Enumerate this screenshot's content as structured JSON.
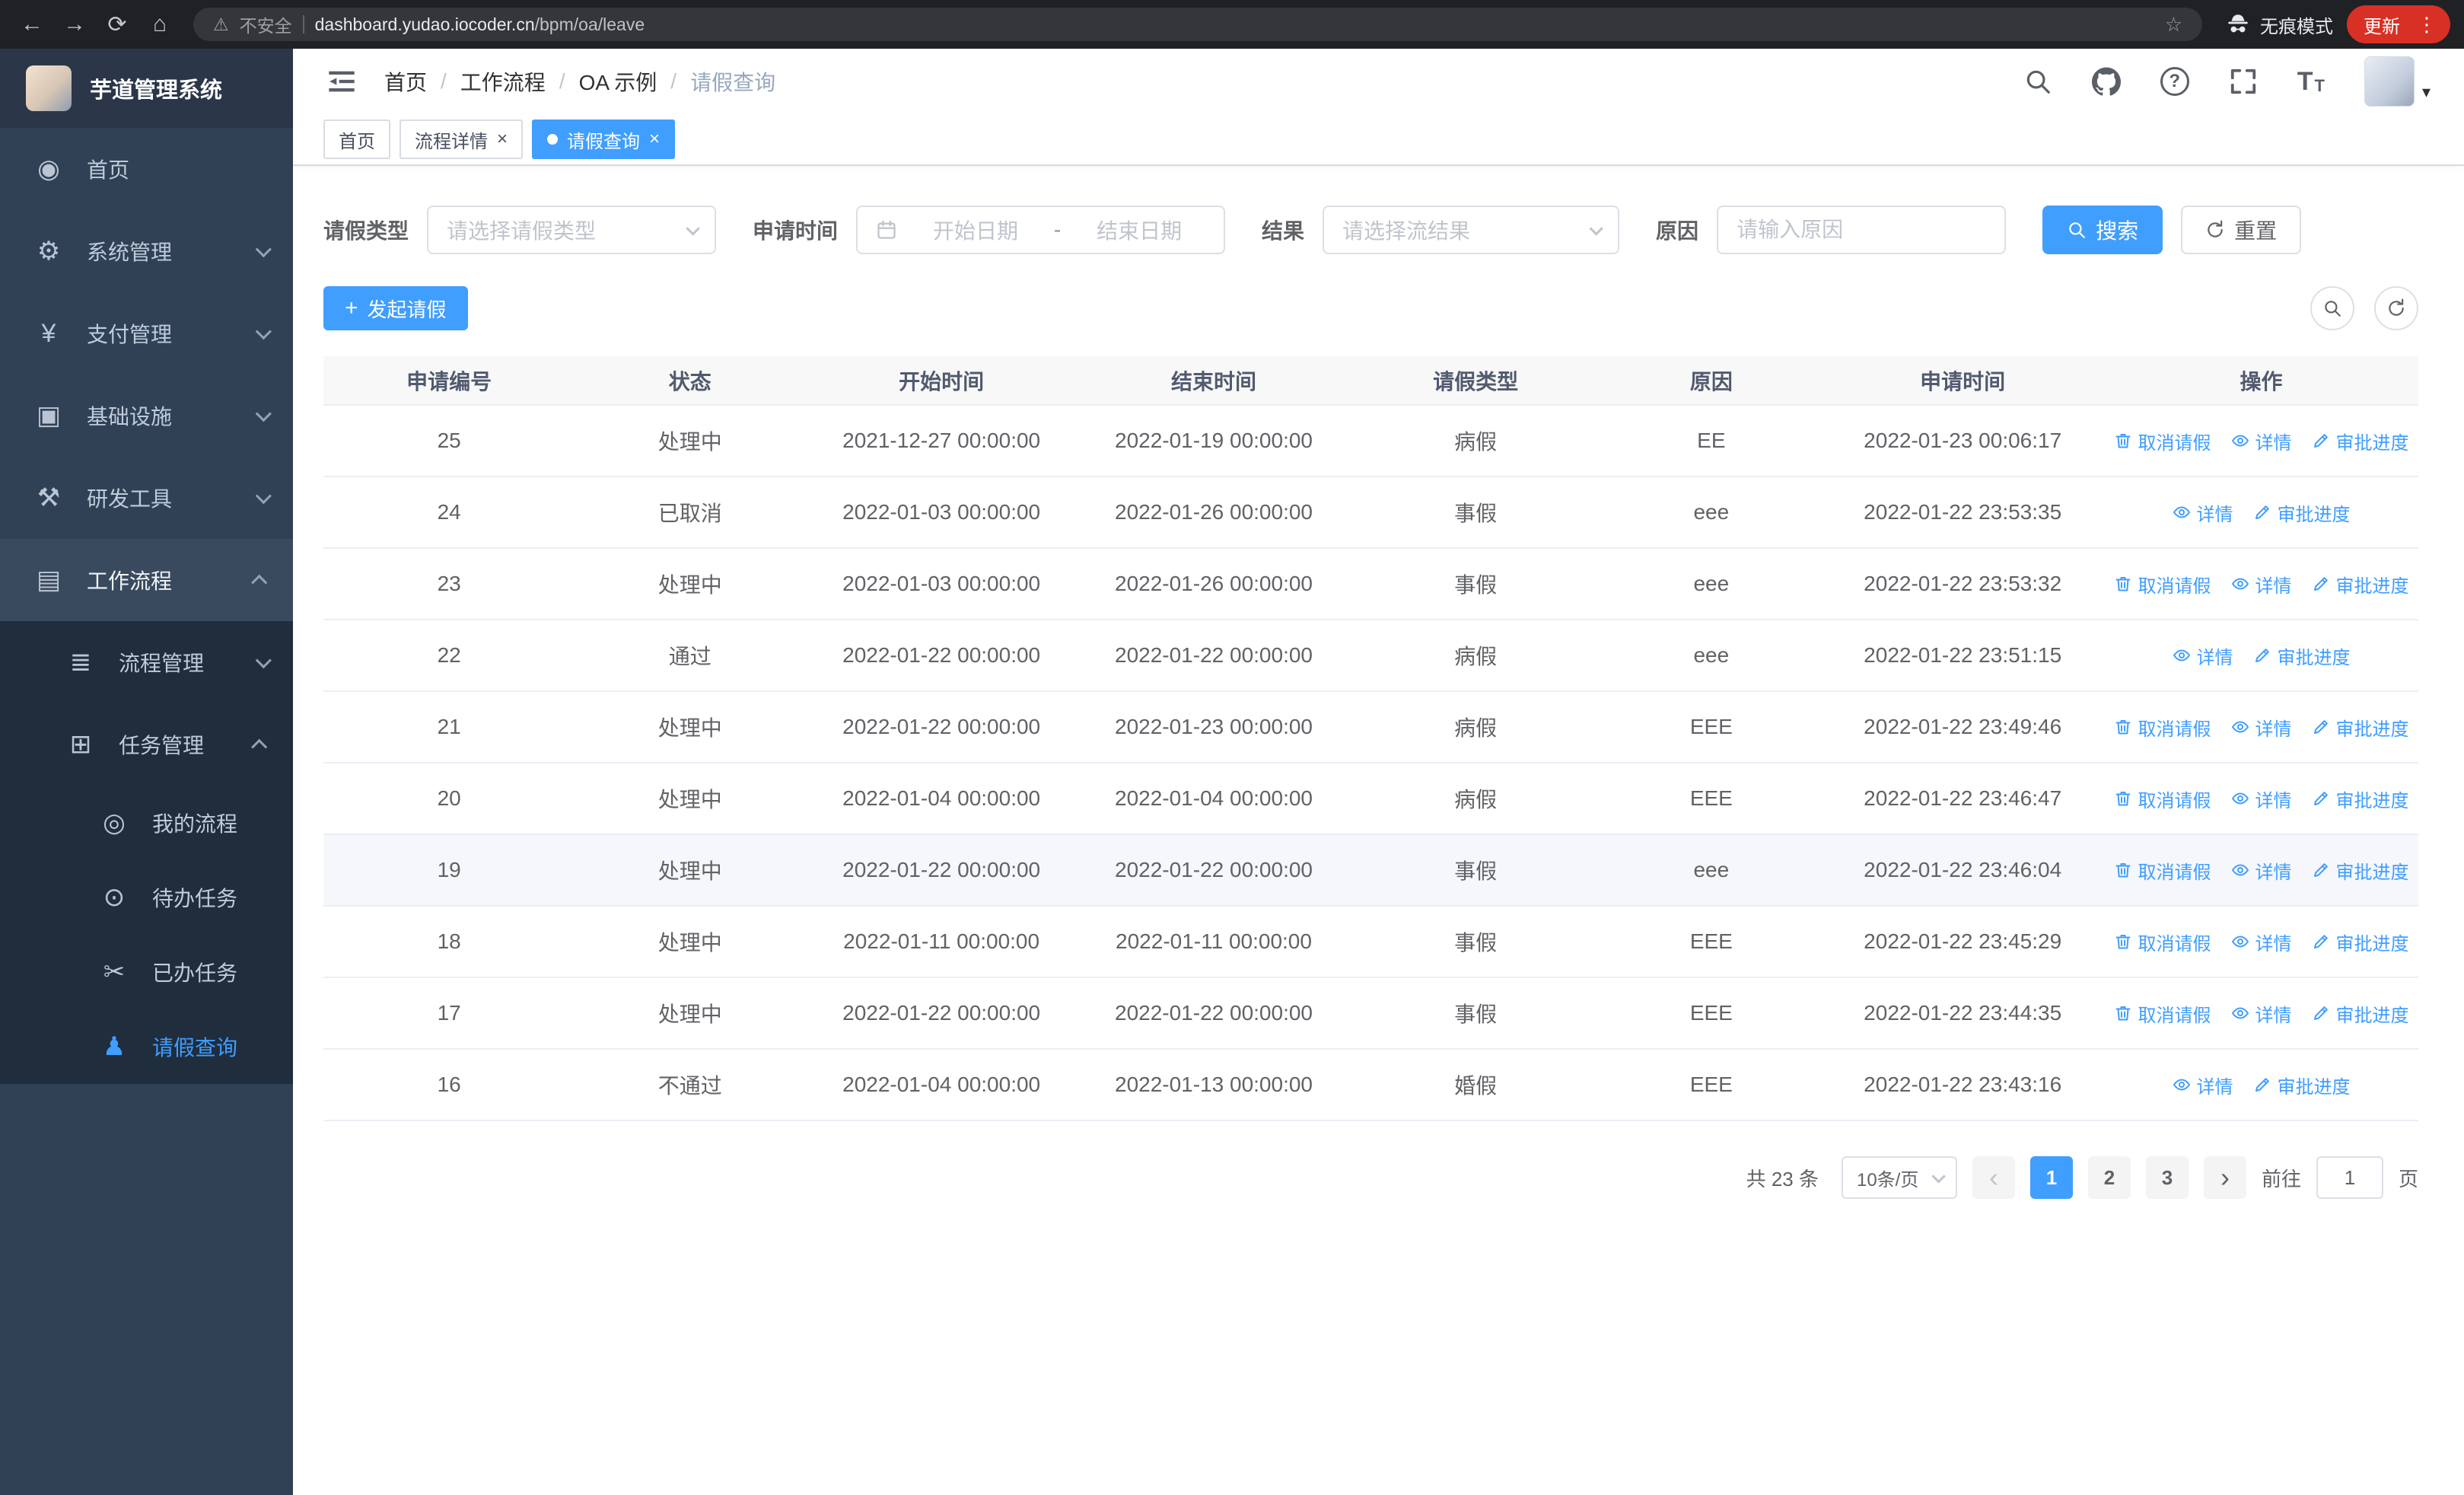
{
  "browser": {
    "security_label": "不安全",
    "url_domain": "dashboard.yudao.iocoder.cn",
    "url_path": "/bpm/oa/leave",
    "incognito_label": "无痕模式",
    "update_label": "更新"
  },
  "icons": {
    "back": "←",
    "forward": "→",
    "reload": "⟳",
    "home": "⌂",
    "warning": "⚠",
    "star": "☆",
    "dots": "⋮",
    "caret": "▾",
    "question": "?",
    "font_big": "T",
    "font_small": "T",
    "plus": "+",
    "chev_left": "‹",
    "chev_right": "›",
    "dashboard": "◉",
    "gear": "⚙",
    "yen": "¥",
    "infrastructure": "▣",
    "tools": "⚒",
    "workflow": "▤",
    "process": "≣",
    "tasks": "⊞",
    "my_process": "◎",
    "todo": "⊙",
    "done": "✂",
    "user": "♟"
  },
  "sidebar": {
    "title": "芋道管理系统",
    "items": [
      {
        "label": "首页"
      },
      {
        "label": "系统管理"
      },
      {
        "label": "支付管理"
      },
      {
        "label": "基础设施"
      },
      {
        "label": "研发工具"
      },
      {
        "label": "工作流程"
      }
    ],
    "workflow_children": [
      {
        "label": "流程管理"
      },
      {
        "label": "任务管理"
      }
    ],
    "task_children": [
      {
        "label": "我的流程"
      },
      {
        "label": "待办任务"
      },
      {
        "label": "已办任务"
      },
      {
        "label": "请假查询"
      }
    ]
  },
  "header": {
    "breadcrumb": [
      "首页",
      "工作流程",
      "OA 示例",
      "请假查询"
    ]
  },
  "tabs": [
    {
      "label": "首页",
      "closable": false,
      "active": false
    },
    {
      "label": "流程详情",
      "closable": true,
      "active": false
    },
    {
      "label": "请假查询",
      "closable": true,
      "active": true
    }
  ],
  "filters": {
    "leave_type_label": "请假类型",
    "leave_type_placeholder": "请选择请假类型",
    "apply_time_label": "申请时间",
    "start_date_placeholder": "开始日期",
    "range_separator": "-",
    "end_date_placeholder": "结束日期",
    "result_label": "结果",
    "result_placeholder": "请选择流结果",
    "reason_label": "原因",
    "reason_placeholder": "请输入原因",
    "search_button": "搜索",
    "reset_button": "重置"
  },
  "toolbar": {
    "create_button": "发起请假"
  },
  "table": {
    "columns": [
      "申请编号",
      "状态",
      "开始时间",
      "结束时间",
      "请假类型",
      "原因",
      "申请时间",
      "操作"
    ],
    "action_labels": {
      "cancel": "取消请假",
      "detail": "详情",
      "progress": "审批进度"
    },
    "rows": [
      {
        "id": "25",
        "status": "处理中",
        "start": "2021-12-27 00:00:00",
        "end": "2022-01-19 00:00:00",
        "type": "病假",
        "reason": "EE",
        "applied": "2022-01-23 00:06:17",
        "actions": [
          "cancel",
          "detail",
          "progress"
        ]
      },
      {
        "id": "24",
        "status": "已取消",
        "start": "2022-01-03 00:00:00",
        "end": "2022-01-26 00:00:00",
        "type": "事假",
        "reason": "eee",
        "applied": "2022-01-22 23:53:35",
        "actions": [
          "detail",
          "progress"
        ]
      },
      {
        "id": "23",
        "status": "处理中",
        "start": "2022-01-03 00:00:00",
        "end": "2022-01-26 00:00:00",
        "type": "事假",
        "reason": "eee",
        "applied": "2022-01-22 23:53:32",
        "actions": [
          "cancel",
          "detail",
          "progress"
        ]
      },
      {
        "id": "22",
        "status": "通过",
        "start": "2022-01-22 00:00:00",
        "end": "2022-01-22 00:00:00",
        "type": "病假",
        "reason": "eee",
        "applied": "2022-01-22 23:51:15",
        "actions": [
          "detail",
          "progress"
        ]
      },
      {
        "id": "21",
        "status": "处理中",
        "start": "2022-01-22 00:00:00",
        "end": "2022-01-23 00:00:00",
        "type": "病假",
        "reason": "EEE",
        "applied": "2022-01-22 23:49:46",
        "actions": [
          "cancel",
          "detail",
          "progress"
        ]
      },
      {
        "id": "20",
        "status": "处理中",
        "start": "2022-01-04 00:00:00",
        "end": "2022-01-04 00:00:00",
        "type": "病假",
        "reason": "EEE",
        "applied": "2022-01-22 23:46:47",
        "actions": [
          "cancel",
          "detail",
          "progress"
        ]
      },
      {
        "id": "19",
        "status": "处理中",
        "start": "2022-01-22 00:00:00",
        "end": "2022-01-22 00:00:00",
        "type": "事假",
        "reason": "eee",
        "applied": "2022-01-22 23:46:04",
        "actions": [
          "cancel",
          "detail",
          "progress"
        ],
        "hover": true
      },
      {
        "id": "18",
        "status": "处理中",
        "start": "2022-01-11 00:00:00",
        "end": "2022-01-11 00:00:00",
        "type": "事假",
        "reason": "EEE",
        "applied": "2022-01-22 23:45:29",
        "actions": [
          "cancel",
          "detail",
          "progress"
        ]
      },
      {
        "id": "17",
        "status": "处理中",
        "start": "2022-01-22 00:00:00",
        "end": "2022-01-22 00:00:00",
        "type": "事假",
        "reason": "EEE",
        "applied": "2022-01-22 23:44:35",
        "actions": [
          "cancel",
          "detail",
          "progress"
        ]
      },
      {
        "id": "16",
        "status": "不通过",
        "start": "2022-01-04 00:00:00",
        "end": "2022-01-13 00:00:00",
        "type": "婚假",
        "reason": "EEE",
        "applied": "2022-01-22 23:43:16",
        "actions": [
          "detail",
          "progress"
        ]
      }
    ]
  },
  "pagination": {
    "total_text": "共 23 条",
    "page_size": "10条/页",
    "pages": [
      "1",
      "2",
      "3"
    ],
    "active_page": "1",
    "goto_prefix": "前往",
    "goto_value": "1",
    "goto_suffix": "页"
  },
  "colors": {
    "primary": "#409eff",
    "sidebar_bg": "#304156",
    "submenu_bg": "#1f2d3d",
    "chrome_bg": "#202124",
    "update_red": "#d93025"
  }
}
